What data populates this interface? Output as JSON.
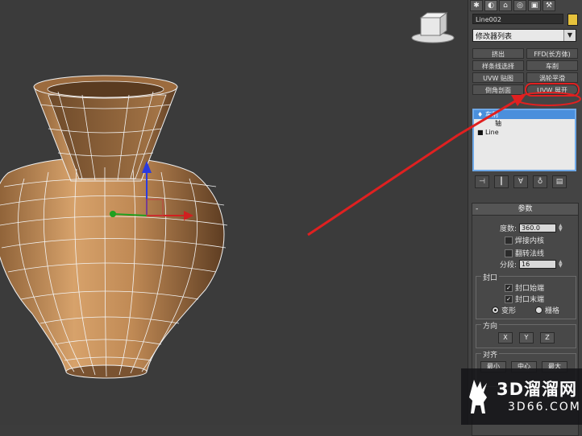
{
  "object_name": "Line002",
  "modifier_list_label": "修改器列表",
  "modifier_buttons": [
    "挤出",
    "FFD(长方体)",
    "样条线选择",
    "车削",
    "UVW 贴图",
    "涡轮平滑",
    "倒角剖面",
    "UVW 展开"
  ],
  "stack": {
    "items": [
      {
        "label": "车削",
        "selected": true
      },
      {
        "label": "轴",
        "selected": false
      },
      {
        "label": "Line",
        "selected": false
      }
    ]
  },
  "params": {
    "title": "参数",
    "degrees_label": "度数:",
    "degrees_value": "360.0",
    "weld_core_label": "焊接内核",
    "flip_normals_label": "翻转法线",
    "segments_label": "分段:",
    "segments_value": "16",
    "capping_label": "封口",
    "cap_start_label": "封口始端",
    "cap_end_label": "封口末端",
    "morph_label": "变形",
    "grid_label": "栅格",
    "direction_label": "方向",
    "x_label": "X",
    "y_label": "Y",
    "z_label": "Z",
    "align_label": "对齐",
    "min_label": "最小",
    "center_label": "中心",
    "max_label": "最大"
  },
  "watermark": {
    "brand": "3D溜溜网",
    "url": "3D66.COM"
  },
  "colors": {
    "vase": "#c8935e",
    "annotation": "#e02020",
    "object_color": "#e6c23c",
    "selection": "#4a8fdc"
  },
  "icons": [
    "create-tab-icon",
    "modify-tab-icon",
    "hierarchy-tab-icon",
    "motion-tab-icon",
    "display-tab-icon",
    "utilities-tab-icon",
    "view-cube-icon"
  ]
}
